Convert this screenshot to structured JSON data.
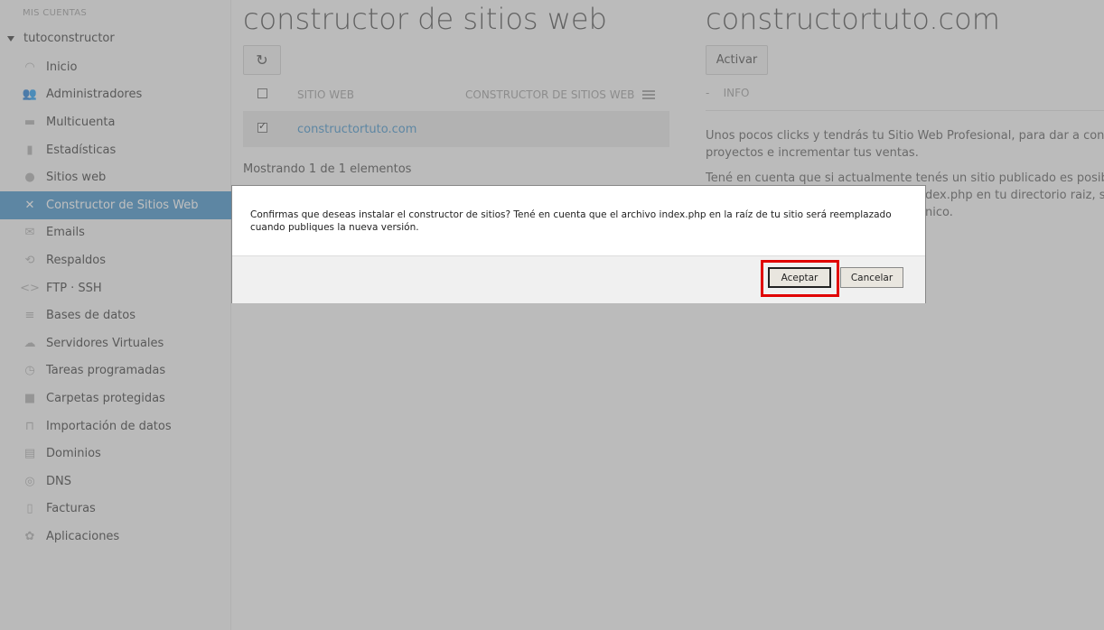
{
  "sidebar": {
    "section_title": "MIS CUENTAS",
    "account": "tutoconstructor",
    "items": [
      {
        "label": "Inicio",
        "icon": "dashboard-icon"
      },
      {
        "label": "Administradores",
        "icon": "users-icon"
      },
      {
        "label": "Multicuenta",
        "icon": "briefcase-icon"
      },
      {
        "label": "Estadísticas",
        "icon": "bar-chart-icon"
      },
      {
        "label": "Sitios web",
        "icon": "globe-icon"
      },
      {
        "label": "Constructor de Sitios Web",
        "icon": "tools-icon"
      },
      {
        "label": "Emails",
        "icon": "envelope-icon"
      },
      {
        "label": "Respaldos",
        "icon": "backup-icon"
      },
      {
        "label": "FTP · SSH",
        "icon": "code-icon"
      },
      {
        "label": "Bases de datos",
        "icon": "database-icon"
      },
      {
        "label": "Servidores Virtuales",
        "icon": "cloud-icon"
      },
      {
        "label": "Tareas programadas",
        "icon": "clock-icon"
      },
      {
        "label": "Carpetas protegidas",
        "icon": "lock-icon"
      },
      {
        "label": "Importación de datos",
        "icon": "import-icon"
      },
      {
        "label": "Dominios",
        "icon": "id-card-icon"
      },
      {
        "label": "DNS",
        "icon": "compass-icon"
      },
      {
        "label": "Facturas",
        "icon": "invoice-icon"
      },
      {
        "label": "Aplicaciones",
        "icon": "apps-icon"
      }
    ],
    "active_index": 5
  },
  "main": {
    "title_left": "constructor de sitios web",
    "title_right": "constructortuto.com",
    "activate_label": "Activar",
    "table": {
      "col_site": "SITIO WEB",
      "col_builder": "CONSTRUCTOR DE SITIOS WEB",
      "rows": [
        {
          "site": "constructortuto.com",
          "checked": true
        }
      ]
    },
    "showing": "Mostrando 1 de 1 elementos",
    "info_tab": "INFO",
    "info_dash": "-",
    "desc_1": "Unos pocos clicks y tendrás tu Sitio Web Profesional, para dar a conocer tu",
    "desc_2": "proyectos e incrementar tus ventas.",
    "desc_3": "Tené en cuenta que si actualmente tenés un sitio publicado es posible que",
    "desc_4": "dex.php en tu directorio raiz, si no",
    "desc_5": "nico."
  },
  "dialog": {
    "message": "Confirmas que deseas instalar el constructor de sitios? Tené en cuenta que el archivo index.php en la raíz de tu sitio será reemplazado cuando publiques la nueva versión.",
    "accept_label": "Aceptar",
    "cancel_label": "Cancelar"
  },
  "colors": {
    "accent": "#3a8dc6",
    "highlight": "#e00000"
  }
}
